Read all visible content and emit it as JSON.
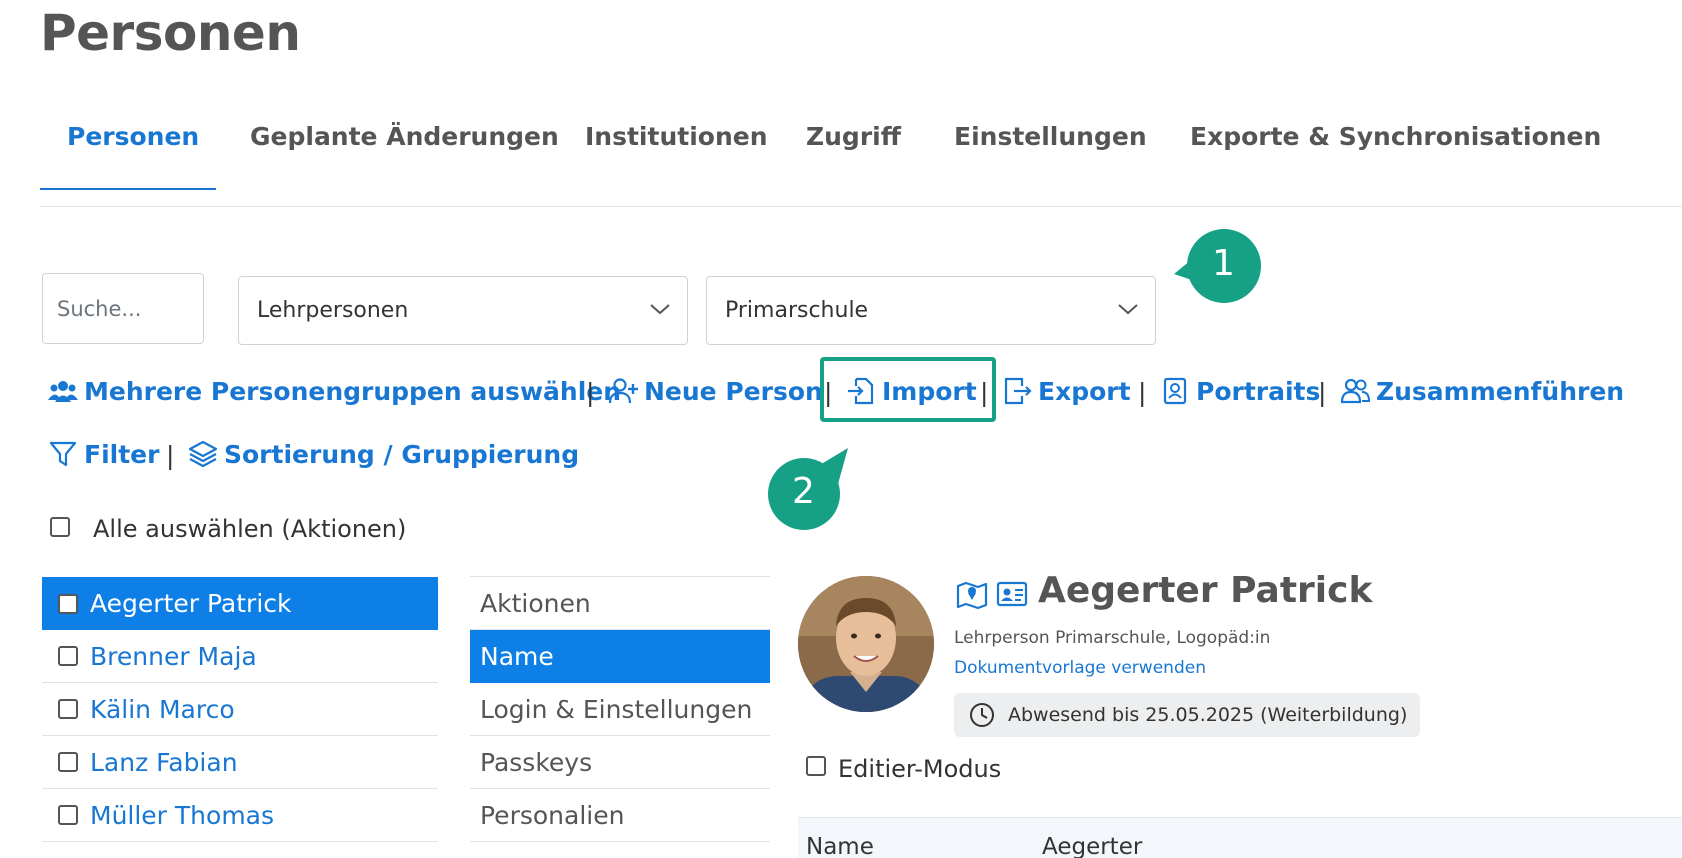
{
  "page": {
    "title": "Personen"
  },
  "tabs": [
    {
      "label": "Personen",
      "active": true
    },
    {
      "label": "Geplante Änderungen",
      "active": false
    },
    {
      "label": "Institutionen",
      "active": false
    },
    {
      "label": "Zugriff",
      "active": false
    },
    {
      "label": "Einstellungen",
      "active": false
    },
    {
      "label": "Exporte & Synchronisationen",
      "active": false
    }
  ],
  "filters": {
    "search_placeholder": "Suche...",
    "group_select": "Lehrpersonen",
    "school_select": "Primarschule"
  },
  "callouts": {
    "one": "1",
    "two": "2"
  },
  "actions": {
    "select_groups": "Mehrere Personengruppen auswählen",
    "new_person": "Neue Person",
    "import": "Import",
    "export": "Export",
    "portraits": "Portraits",
    "merge": "Zusammenführen",
    "filter": "Filter",
    "sort_group": "Sortierung / Gruppierung",
    "separator": "|"
  },
  "select_all_label": "Alle auswählen (Aktionen)",
  "people": [
    {
      "name": "Aegerter Patrick",
      "selected": true
    },
    {
      "name": "Brenner Maja",
      "selected": false
    },
    {
      "name": "Kälin Marco",
      "selected": false
    },
    {
      "name": "Lanz Fabian",
      "selected": false
    },
    {
      "name": "Müller Thomas",
      "selected": false
    }
  ],
  "menu": [
    {
      "label": "Aktionen",
      "selected": false
    },
    {
      "label": "Name",
      "selected": true
    },
    {
      "label": "Login & Einstellungen",
      "selected": false
    },
    {
      "label": "Passkeys",
      "selected": false
    },
    {
      "label": "Personalien",
      "selected": false
    }
  ],
  "detail": {
    "name": "Aegerter Patrick",
    "role": "Lehrperson Primarschule, Logopäd:in",
    "template_link": "Dokumentvorlage verwenden",
    "absence": "Abwesend bis 25.05.2025 (Weiterbildung)",
    "edit_mode": "Editier-Modus",
    "table_label": "Name",
    "table_value": "Aegerter"
  },
  "colors": {
    "accent": "#1877d2",
    "selected_bg": "#0d7fe6",
    "callout": "#16a085"
  }
}
